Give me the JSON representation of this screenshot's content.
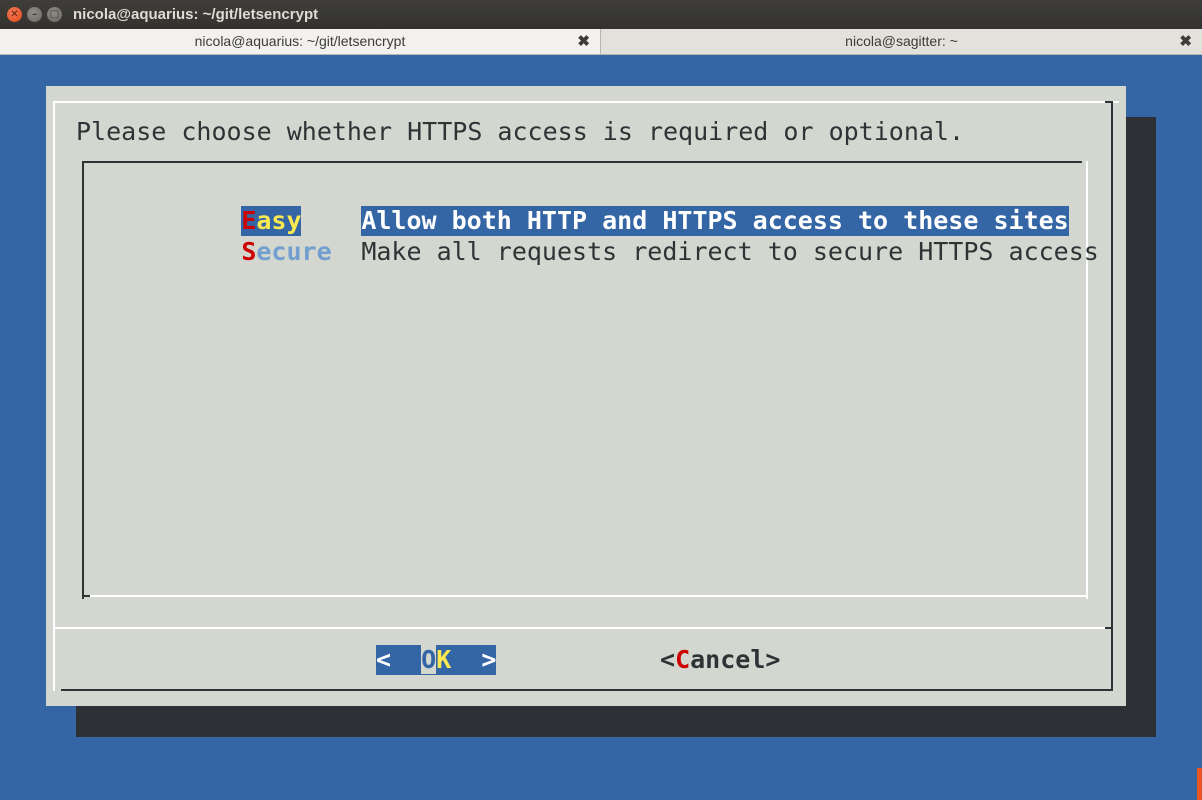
{
  "window": {
    "title": "nicola@aquarius: ~/git/letsencrypt",
    "controls": {
      "close_glyph": "✕",
      "min_glyph": "–",
      "max_glyph": "□"
    }
  },
  "tabs": [
    {
      "label": "nicola@aquarius: ~/git/letsencrypt",
      "close": "✖",
      "active": true
    },
    {
      "label": "nicola@sagitter: ~",
      "close": "✖",
      "active": false
    }
  ],
  "dialog": {
    "prompt": "Please choose whether HTTPS access is required or optional.",
    "options": [
      {
        "tag_hotkey": "E",
        "tag_rest": "asy",
        "description": "Allow both HTTP and HTTPS access to these sites",
        "selected": true
      },
      {
        "tag_hotkey": "S",
        "tag_rest": "ecure",
        "description": "Make all requests redirect to secure HTTPS access",
        "selected": false
      }
    ],
    "buttons": {
      "ok": {
        "left": "<  ",
        "cursor_char": "O",
        "hotkey": "K",
        "right": "  >"
      },
      "cancel": {
        "left": "<",
        "hotkey": "C",
        "rest": "ancel",
        "right": ">"
      }
    }
  },
  "colors": {
    "terminal_background": "#3465a4",
    "dialog_background": "#d3d7cf",
    "selection": "#3465a4",
    "hotkey": "#cc0000",
    "tag_highlight": "#fce94f"
  }
}
